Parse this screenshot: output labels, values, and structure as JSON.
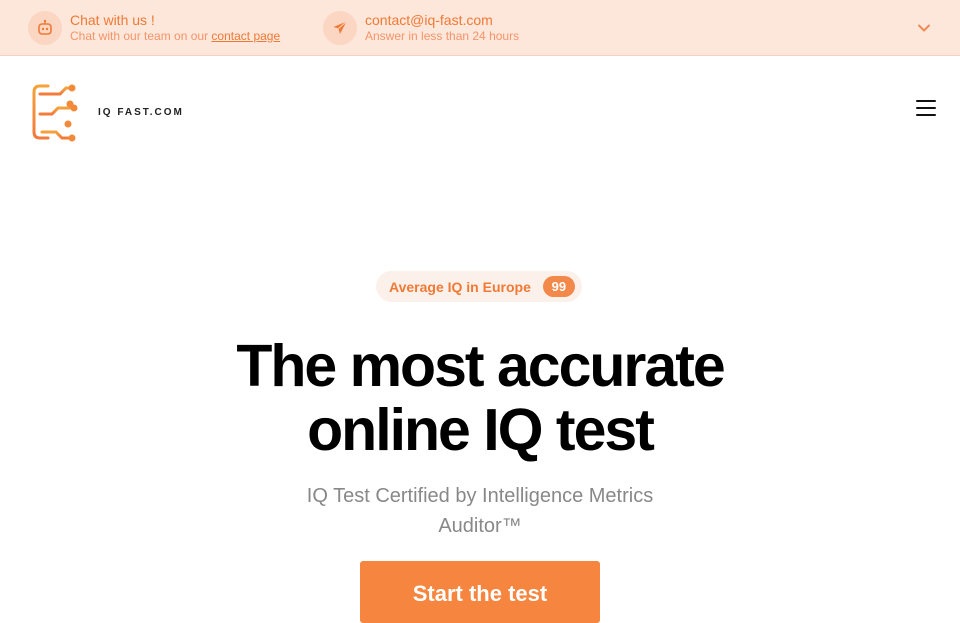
{
  "topbar": {
    "chat": {
      "icon": "robot-chat-icon",
      "title": "Chat with us !",
      "sub_prefix": "Chat with our team on our",
      "sub_link": "contact page"
    },
    "email": {
      "icon": "paper-plane-icon",
      "title": "contact@iq-fast.com",
      "sub": "Answer in less than 24 hours"
    },
    "chevron_icon": "chevron-down-icon"
  },
  "header": {
    "logo_text": "IQ FAST.COM",
    "menu_icon": "hamburger-menu-icon"
  },
  "hero": {
    "badge_label": "Average IQ in Europe",
    "badge_value": "99",
    "title_line1": "The most accurate",
    "title_line2": "online IQ test",
    "subtitle": "IQ Test Certified by Intelligence Metrics Auditor™",
    "cta_label": "Start the test"
  },
  "colors": {
    "accent": "#f07a35",
    "topbar_bg": "#fde6da",
    "badge_bg": "#fcf0ea"
  }
}
